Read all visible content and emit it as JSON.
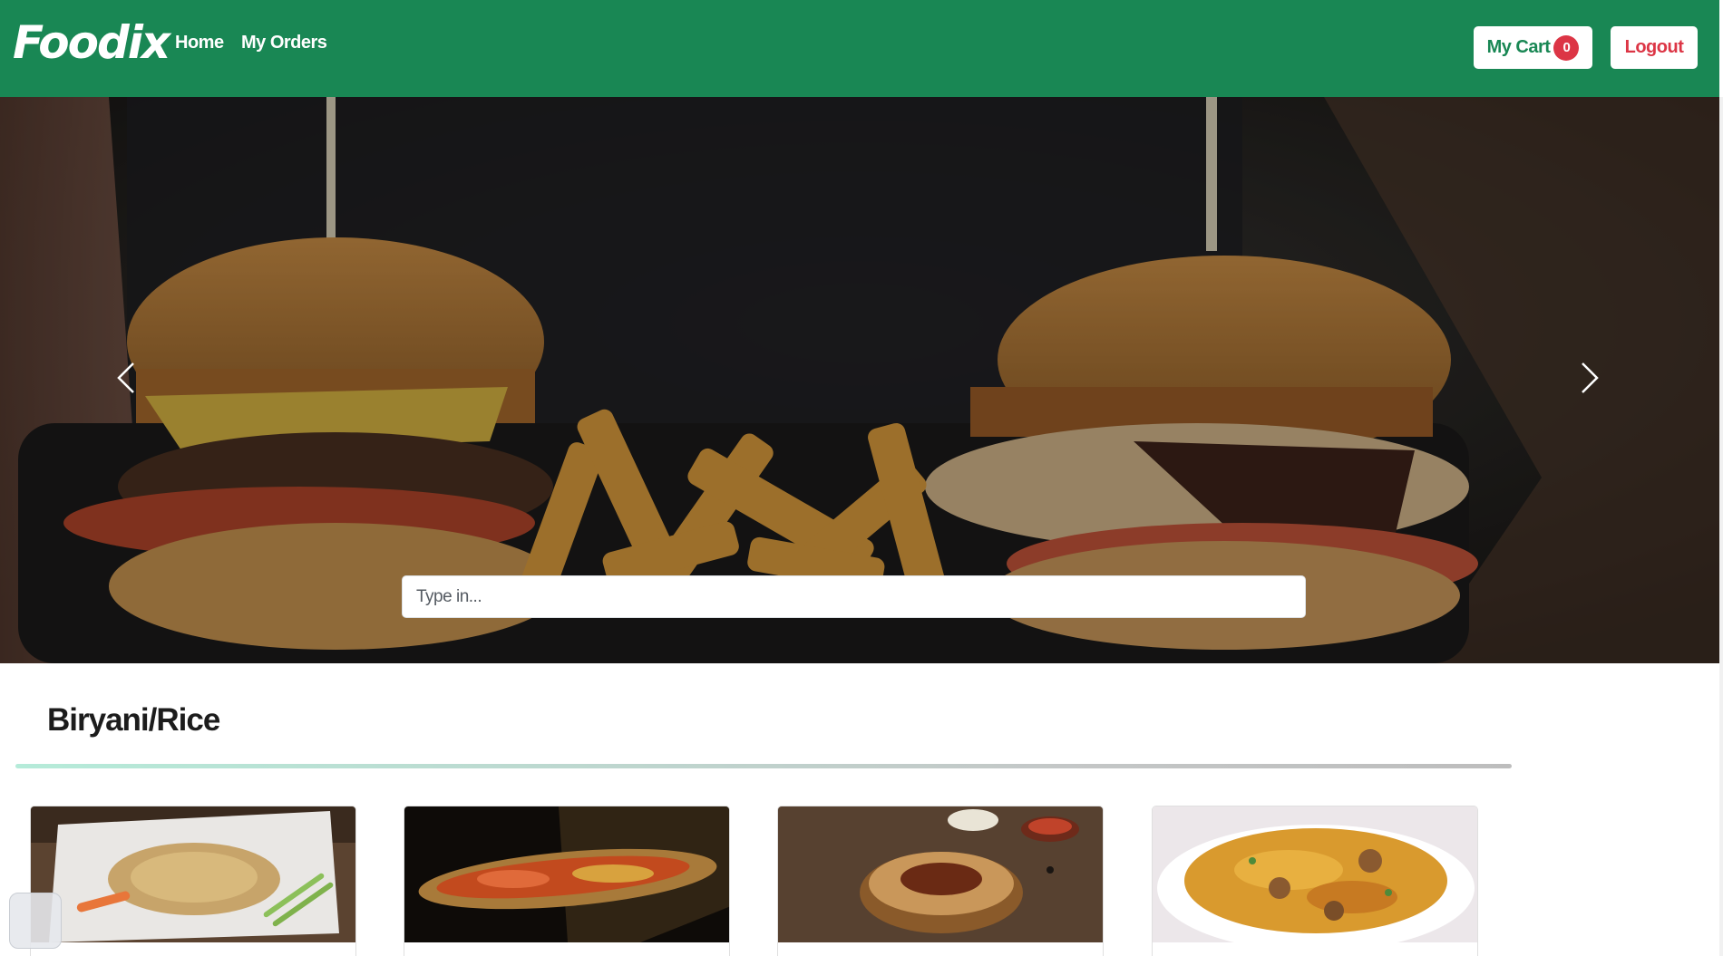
{
  "navbar": {
    "brand": "Foodix",
    "links": {
      "home": "Home",
      "orders": "My Orders"
    },
    "cart_label": "My Cart",
    "cart_count": "0",
    "logout_label": "Logout",
    "colors": {
      "background": "#198754",
      "cart_text": "#198754",
      "logout_text": "#dc3545",
      "badge": "#dc3545"
    }
  },
  "hero": {
    "search_placeholder": "Type in...",
    "prev_icon": "chevron-left-icon",
    "next_icon": "chevron-right-icon"
  },
  "category": {
    "title": "Biryani/Rice",
    "cards": [
      {
        "image": "fried-rice-plate"
      },
      {
        "image": "biryani-platter"
      },
      {
        "image": "biryani-bowl"
      },
      {
        "image": "chicken-biryani-plate"
      }
    ]
  }
}
